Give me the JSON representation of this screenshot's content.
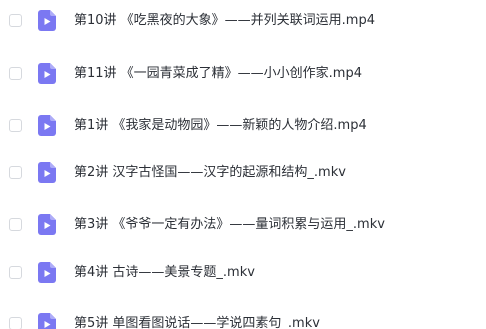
{
  "files": [
    {
      "name": "第10讲 《吃黑夜的大象》——并列关联词运用.mp4",
      "icon": "video-file-icon"
    },
    {
      "name": "第11讲 《一园青菜成了精》——小小创作家.mp4",
      "icon": "video-file-icon"
    },
    {
      "name": "第1讲 《我家是动物园》——新颖的人物介绍.mp4",
      "icon": "video-file-icon"
    },
    {
      "name": "第2讲 汉字古怪国——汉字的起源和结构_.mkv",
      "icon": "video-file-icon"
    },
    {
      "name": "第3讲 《爷爷一定有办法》——量词积累与运用_.mkv",
      "icon": "video-file-icon"
    },
    {
      "name": "第4讲 古诗——美景专题_.mkv",
      "icon": "video-file-icon"
    },
    {
      "name": "第5讲 单图看图说话——学说四素句_.mkv",
      "icon": "video-file-icon"
    }
  ],
  "colors": {
    "icon_fill": "#7b78f2",
    "icon_fold": "#aeacf8",
    "text": "#2b2f36",
    "checkbox_border": "#d6d9de"
  }
}
